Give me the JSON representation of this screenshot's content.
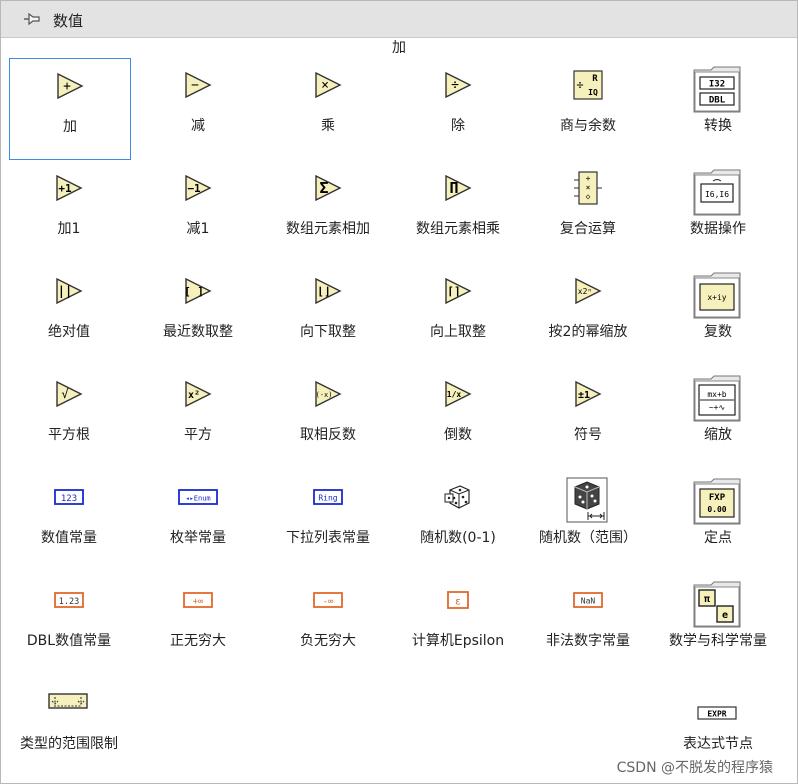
{
  "window": {
    "title": "数值"
  },
  "hover_label": "加",
  "items": [
    {
      "label": "加"
    },
    {
      "label": "减"
    },
    {
      "label": "乘"
    },
    {
      "label": "除"
    },
    {
      "label": "商与余数"
    },
    {
      "label": "转换"
    },
    {
      "label": "加1"
    },
    {
      "label": "减1"
    },
    {
      "label": "数组元素相加"
    },
    {
      "label": "数组元素相乘"
    },
    {
      "label": "复合运算"
    },
    {
      "label": "数据操作"
    },
    {
      "label": "绝对值"
    },
    {
      "label": "最近数取整"
    },
    {
      "label": "向下取整"
    },
    {
      "label": "向上取整"
    },
    {
      "label": "按2的幂缩放"
    },
    {
      "label": "复数"
    },
    {
      "label": "平方根"
    },
    {
      "label": "平方"
    },
    {
      "label": "取相反数"
    },
    {
      "label": "倒数"
    },
    {
      "label": "符号"
    },
    {
      "label": "缩放"
    },
    {
      "label": "数值常量"
    },
    {
      "label": "枚举常量"
    },
    {
      "label": "下拉列表常量"
    },
    {
      "label": "随机数(0-1)"
    },
    {
      "label": "随机数（范围）"
    },
    {
      "label": "定点"
    },
    {
      "label": "DBL数值常量"
    },
    {
      "label": "正无穷大"
    },
    {
      "label": "负无穷大"
    },
    {
      "label": "计算机Epsilon"
    },
    {
      "label": "非法数字常量"
    },
    {
      "label": "数学与科学常量"
    },
    {
      "label": "类型的范围限制"
    },
    {
      "label": "表达式节点"
    }
  ],
  "icons": {
    "add": "+",
    "subtract": "−",
    "multiply": "×",
    "divide": "÷",
    "quotient_r": "R",
    "quotient_iq": "IQ",
    "conv_i32": "I32",
    "conv_dbl": "DBL",
    "inc": "+1",
    "dec": "−1",
    "sum": "Σ",
    "prod": "Π",
    "dm_text": "I6,I6",
    "abs": "||",
    "round": "[ ]",
    "floor": "⌊⌋",
    "ceil": "⌈⌉",
    "pow2": "x2ⁿ",
    "complex": "x+iy",
    "sqrt": "√",
    "square": "x²",
    "negate": "(-x)",
    "recip": "1/x",
    "sign": "±1",
    "scale_a": "mx+b",
    "scale_b": "~+∿",
    "numeric_const": "123",
    "enum_const": "◂▸Enum",
    "ring_const": "Ring",
    "fxp_a": "FXP",
    "fxp_b": "0.00",
    "dbl_const": "1.23",
    "pos_inf": "+∞",
    "neg_inf": "-∞",
    "epsilon": "ε",
    "nan": "NaN",
    "pi": "π",
    "e": "e",
    "expr": "EXPR"
  },
  "watermark": "CSDN @不脱发的程序猿",
  "colors": {
    "accent": "#3c8de0",
    "triangle_fill": "#f6f0bc",
    "numeric_blue": "#1a2bd0",
    "dbl_orange": "#e06a2c"
  }
}
